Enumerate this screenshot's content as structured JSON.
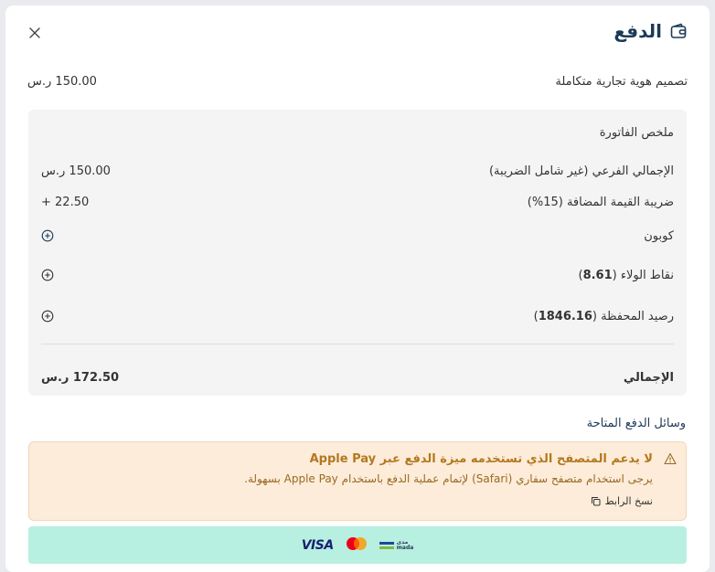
{
  "header": {
    "title": "الدفع",
    "close_icon": "close-icon",
    "wallet_icon": "wallet-icon"
  },
  "service": {
    "name": "تصميم هوية تجارية متكاملة",
    "price": "150.00 ر.س"
  },
  "summary": {
    "heading": "ملخص الفاتورة",
    "subtotal_label": "الإجمالي الفرعي (غير شامل الضريبة)",
    "subtotal_value": "150.00 ر.س",
    "vat_label": "ضريبة القيمة المضافة (15%)",
    "vat_value": "+ 22.50",
    "coupon_label": "كوبون",
    "loyalty_label": "نقاط الولاء (",
    "loyalty_points": "8.61",
    "loyalty_close": ")",
    "wallet_label": "رصيد المحفظة (",
    "wallet_balance": "1846.16",
    "wallet_close": ")",
    "total_label": "الإجمالي",
    "total_value": "172.50 ر.س"
  },
  "payment": {
    "methods_label": "وسائل الدفع المتاحة",
    "warning_title": "لا يدعم المتصفح الذي تستخدمه ميزة الدفع عبر Apple Pay",
    "warning_body": "يرجى استخدام متصفح سفاري (Safari) لإتمام عملية الدفع باستخدام Apple Pay بسهولة.",
    "copy_link_label": "نسخ الرابط",
    "visa_label": "VISA",
    "mada_label": "mada",
    "mada_arabic": "مدى",
    "colors": {
      "pay_bar": "#b7f0e0",
      "warning_bg": "#fcecd9",
      "warning_text": "#b4781f",
      "title": "#1c3a57"
    }
  }
}
